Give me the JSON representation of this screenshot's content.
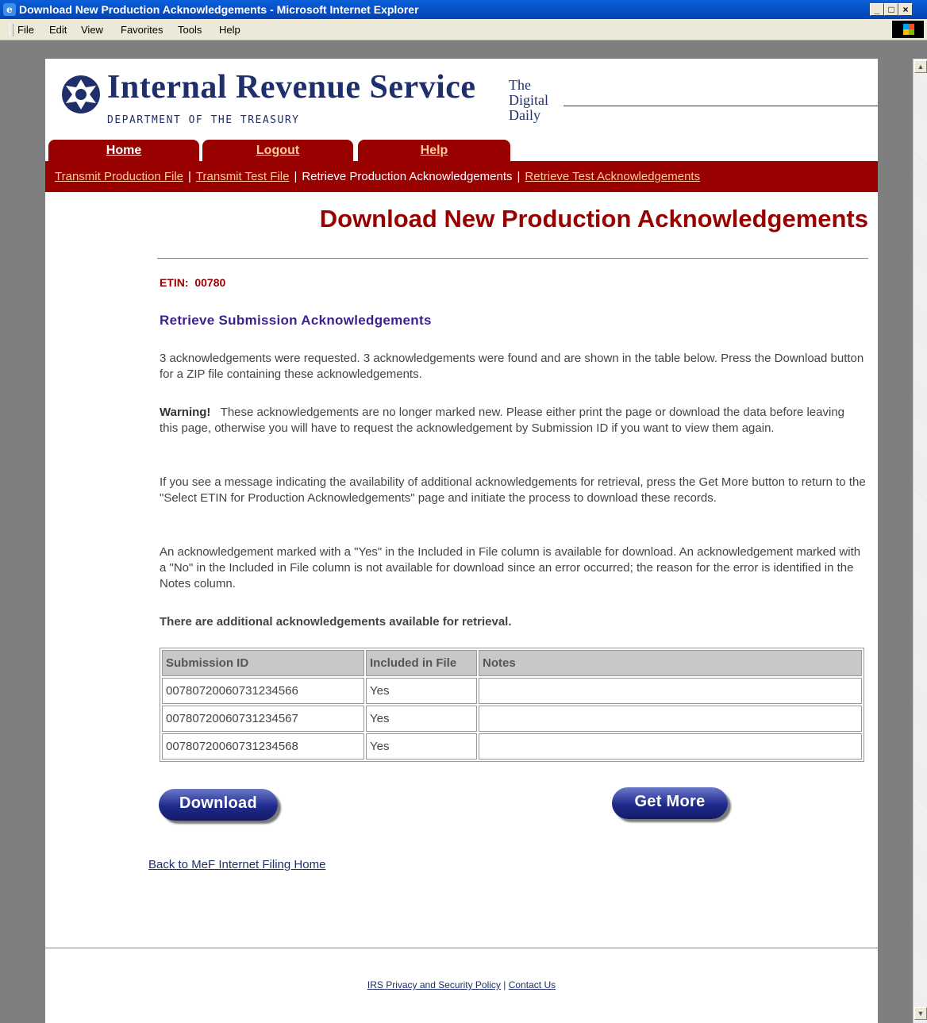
{
  "window": {
    "title": "Download New Production Acknowledgements - Microsoft Internet Explorer",
    "minimize": "_",
    "maximize": "□",
    "close": "×"
  },
  "menu": [
    "File",
    "Edit",
    "View",
    "Favorites",
    "Tools",
    "Help"
  ],
  "header": {
    "title": "Internal Revenue Service",
    "dept": "DEPARTMENT OF THE TREASURY",
    "digital_daily": [
      "The",
      "Digital",
      "Daily"
    ]
  },
  "tabs": [
    {
      "label": "Home"
    },
    {
      "label": "Logout"
    },
    {
      "label": "Help"
    }
  ],
  "subnav": {
    "transmit_production": "Transmit Production File",
    "transmit_test": "Transmit Test File",
    "retrieve_production": "Retrieve Production Acknowledgements",
    "retrieve_test": "Retrieve Test Acknowledgements",
    "separator": "|"
  },
  "page_title": "Download New Production Acknowledgements",
  "etin": {
    "label": "ETIN:",
    "value": "00780"
  },
  "section_title": "Retrieve Submission Acknowledgements",
  "paragraphs": {
    "p1": "3 acknowledgements were requested. 3 acknowledgements were found and are shown in the table below. Press the Download button for a ZIP file containing these acknowledgements.",
    "warning_label": "Warning!",
    "p2": "These acknowledgements are no longer marked new. Please either print the page or download the data before leaving this page, otherwise you will have to request the acknowledgement by Submission ID if you want to view them again.",
    "p3": "If you see a message indicating the availability of additional acknowledgements for retrieval, press the Get More button to return to the \"Select ETIN for Production Acknowledgements\" page and initiate the process to download these records.",
    "p4": "An acknowledgement marked with a \"Yes\" in the Included in File column is available for download. An acknowledgement marked with a \"No\" in the Included in File column is not available for download since an error occurred; the reason for the error is identified in the Notes column."
  },
  "additional_notice": "There are additional acknowledgements available for retrieval.",
  "table": {
    "headers": [
      "Submission ID",
      "Included in File",
      "Notes"
    ],
    "rows": [
      [
        "00780720060731234566",
        "Yes",
        ""
      ],
      [
        "00780720060731234567",
        "Yes",
        ""
      ],
      [
        "00780720060731234568",
        "Yes",
        ""
      ]
    ]
  },
  "buttons": {
    "download": "Download",
    "get_more": "Get More"
  },
  "back_link": "Back to MeF Internet Filing Home",
  "footer": {
    "privacy": "IRS Privacy and Security Policy",
    "separator": "|",
    "contact": "Contact Us"
  },
  "colors": {
    "brand_red": "#990000",
    "irs_blue": "#1f2f6b",
    "button_blue": "#1f2a8c"
  }
}
